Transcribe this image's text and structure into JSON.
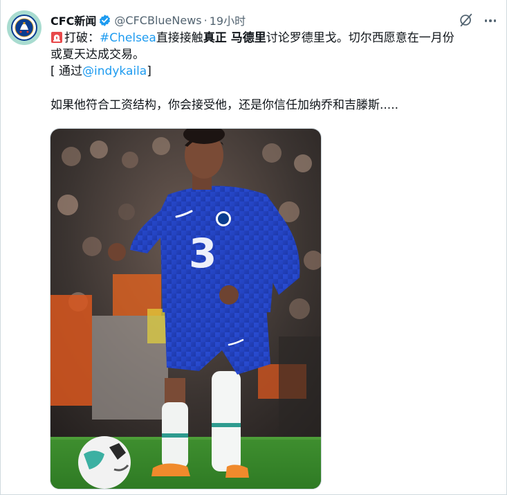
{
  "tweet": {
    "author": {
      "display_name": "CFC新闻",
      "handle": "@CFCBlueNews",
      "separator": "·",
      "time": "19小时"
    },
    "text": {
      "hashtag": "#Chelsea",
      "part1": "打破：",
      "part2": "直接接触",
      "bold1": "真正 马德里",
      "part3": "讨论罗德里戈。切尔西愿意在一月份",
      "line2": "或夏天达成交易。",
      "via_open": "[ 通过",
      "via_handle": "@indykaila",
      "via_close": "]",
      "question": "如果他符合工资结构，你会接受他，还是你信任加纳乔和吉滕斯....."
    },
    "icons": {
      "avatar": "chelsea-crest-icon",
      "verified": "verified-badge-icon",
      "siren": "siren-emoji-icon",
      "grok": "grok-icon",
      "more": "more-options-icon"
    },
    "colors": {
      "link": "#1d9bf0",
      "text": "#0f1419",
      "muted": "#536471",
      "avatar_bg": "#a9dcd0",
      "kit_blue": "#1f3fb8"
    }
  }
}
